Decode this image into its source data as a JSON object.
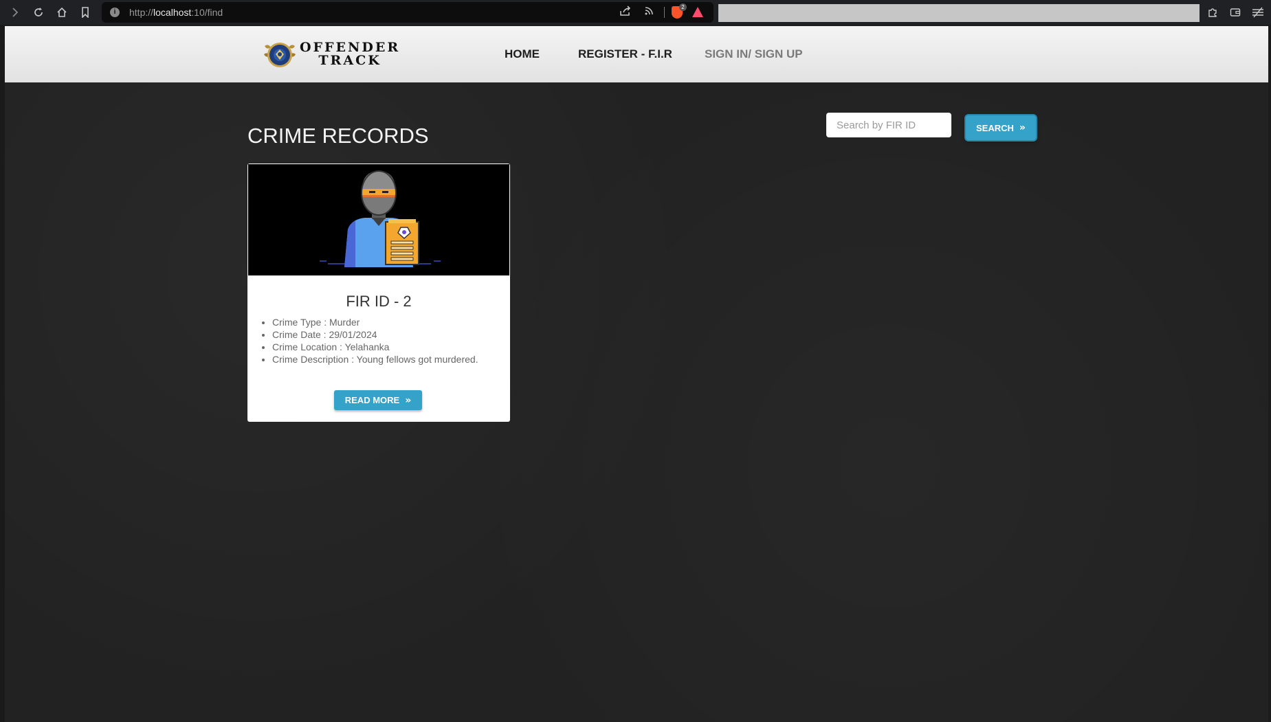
{
  "browser": {
    "url_prefix": "http://",
    "url_host": "localhost",
    "url_rest": ":10/find",
    "shields_count": "2"
  },
  "header": {
    "logo_line1": "OFFENDER",
    "logo_line2": "TRACK",
    "nav": [
      {
        "label": "HOME"
      },
      {
        "label": "REGISTER - F.I.R"
      },
      {
        "label": "SIGN IN/ SIGN UP"
      }
    ]
  },
  "main": {
    "title": "CRIME RECORDS",
    "search": {
      "placeholder": "Search by FIR ID",
      "value": "",
      "button_label": "SEARCH"
    },
    "records": [
      {
        "title": "FIR ID - 2",
        "details": [
          "Crime Type : Murder",
          "Crime Date : 29/01/2024",
          "Crime Location : Yelahanka",
          "Crime Description : Young fellows got murdered."
        ],
        "button_label": "READ MORE",
        "image_icon": "criminal-with-case-file-icon"
      }
    ]
  },
  "colors": {
    "accent": "#34a2c9",
    "background": "#222222",
    "header_bg": "#eeeeee"
  }
}
